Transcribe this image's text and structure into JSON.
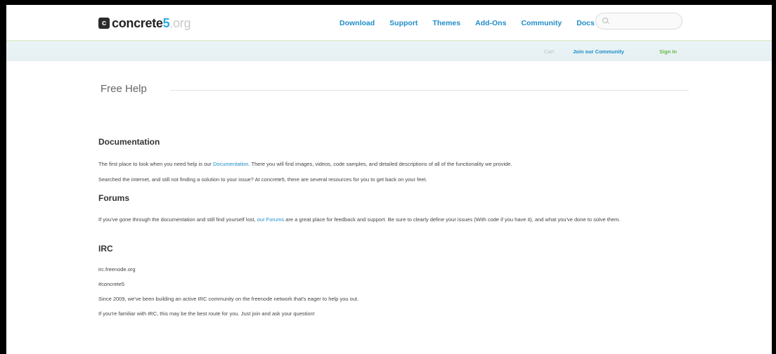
{
  "header": {
    "logo_name": "concrete",
    "logo_five": "5",
    "logo_tld": ".org",
    "nav": [
      "Download",
      "Support",
      "Themes",
      "Add-Ons",
      "Community",
      "Docs"
    ],
    "search_placeholder": ""
  },
  "subnav": {
    "cart": "Cart",
    "join": "Join our Community",
    "signin": "Sign In"
  },
  "page": {
    "title": "Free Help"
  },
  "sections": {
    "documentation": {
      "heading": "Documentation",
      "p1_before": "The first place to look when you need help is our ",
      "p1_link": "Documentation",
      "p1_after": ". There you will find images, videos, code samples, and detailed descriptions of all of the functionality we provide.",
      "p2": " Searched the internet, and still not finding a solution to your issue? At concrete5, there are several resources for you to get back on your feet."
    },
    "forums": {
      "heading": "Forums",
      "p1_before": "If you've gone through the documentation and still find yourself lost, ",
      "p1_link": "our Forums",
      "p1_after": " are a great place for feedback and support. Be sure to clearly define your issues (With code if you have it), and what you've done to solve them."
    },
    "irc": {
      "heading": "IRC",
      "server": "irc.freenode.org",
      "channel": "#concrete5",
      "p1": "Since 2009, we've been building an active IRC community on the freenode network that's eager to help you out.",
      "p2": "If you're familiar with IRC, this may be the best route for you. Just join and ask your question!"
    }
  },
  "colors": {
    "link": "#1f8dc8",
    "signin": "#6ab84a",
    "logo_accent": "#29a8e0"
  }
}
